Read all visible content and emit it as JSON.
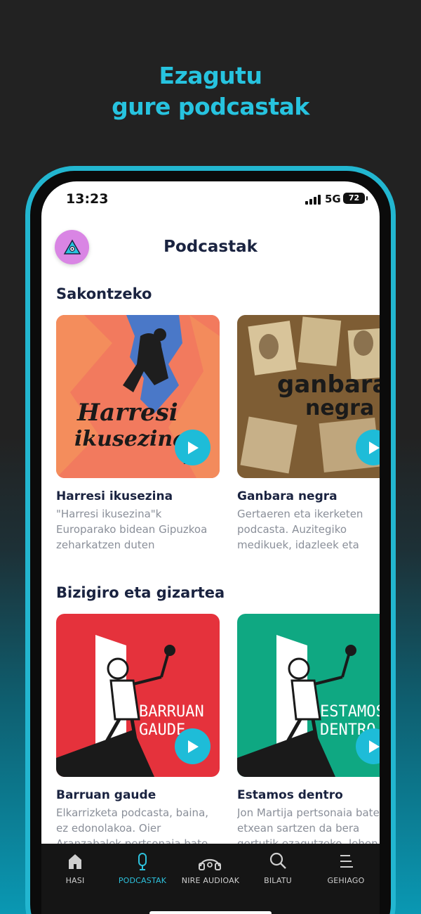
{
  "headline": {
    "line1": "Ezagutu",
    "line2": "gure podcastak"
  },
  "status_bar": {
    "time": "13:23",
    "network": "5G",
    "battery": "72"
  },
  "header": {
    "title": "Podcastak",
    "avatar_icon": "warning-triangle-logo-icon"
  },
  "sections": [
    {
      "title": "Sakontzeko",
      "cards": [
        {
          "title": "Harresi ikusezina",
          "desc_lines": [
            "\"Harresi ikusezina\"k",
            "Europarako bidean Gipuzkoa",
            "zeharkatzen duten migratzail..."
          ],
          "art_text": [
            "Harresi",
            "ikusezina"
          ]
        },
        {
          "title": "Ganbara negra",
          "desc_lines": [
            "Gertaeren eta ikerketen",
            "podcasta. Auzitegiko",
            "medikuek, idazleek eta poliz"
          ],
          "art_text": [
            "ganbara",
            "negra"
          ]
        }
      ]
    },
    {
      "title": "Bizigiro eta gizartea",
      "cards": [
        {
          "title": "Barruan gaude",
          "desc_lines": [
            "Elkarrizketa podcasta, baina,",
            "ez edonolakoa. Oier",
            "Aranzabalek pertsonaia bate..."
          ],
          "art_text": [
            "BARRUAN",
            "GAUDE"
          ]
        },
        {
          "title": "Estamos dentro",
          "desc_lines": [
            "Jon Martija pertsonaia bate",
            "etxean sartzen da bera",
            "gertutik ezagutzeko, lehen b"
          ],
          "art_text": [
            "ESTAMOS",
            "DENTRO"
          ]
        }
      ]
    }
  ],
  "tabs": [
    {
      "label": "HASI",
      "icon": "home-icon",
      "active": false
    },
    {
      "label": "PODCASTAK",
      "icon": "microphone-icon",
      "active": true
    },
    {
      "label": "NIRE AUDIOAK",
      "icon": "headphones-icon",
      "active": false
    },
    {
      "label": "BILATU",
      "icon": "search-icon",
      "active": false
    },
    {
      "label": "GEHIAGO",
      "icon": "menu-icon",
      "active": false
    }
  ],
  "colors": {
    "accent": "#1ebcd8",
    "title_text": "#1a2340",
    "desc_text": "#8a8f99",
    "tab_bar": "#151515"
  }
}
